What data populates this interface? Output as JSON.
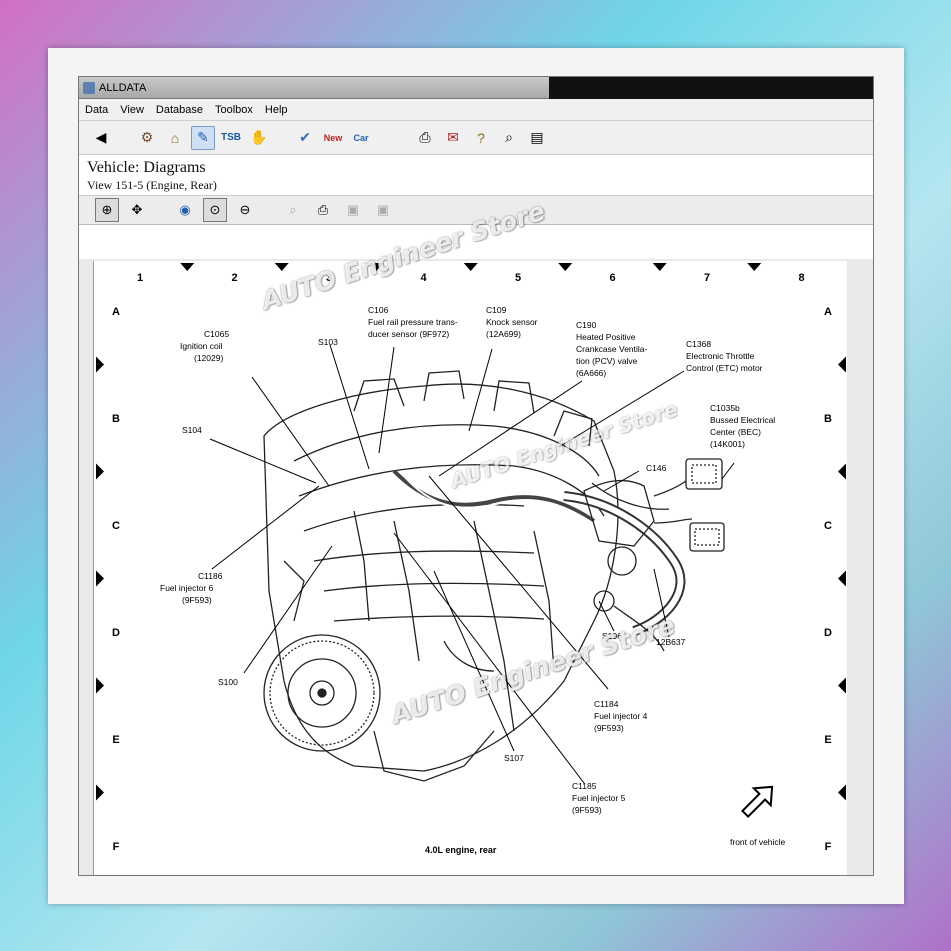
{
  "window": {
    "title": "ALLDATA"
  },
  "menu": [
    "Data",
    "View",
    "Database",
    "Toolbox",
    "Help"
  ],
  "toolbar_icons": [
    "back-icon",
    "component-icon",
    "home-icon",
    "diagram-tool-icon",
    "tsb-icon",
    "wrench-icon",
    "repair-icon",
    "new-car-icon",
    "new-car-2-icon",
    "print-icon",
    "note-icon",
    "help-icon",
    "search-icon",
    "print-preview-icon"
  ],
  "vehicle": {
    "title": "Vehicle:  Diagrams",
    "view": "View 151-5 (Engine, Rear)"
  },
  "diagram_tools": [
    "zoom-box-icon",
    "pan-icon",
    "zoom-100-icon",
    "zoom-in-icon",
    "zoom-out-icon",
    "zoom-disabled-icon",
    "print-icon",
    "camera-icon",
    "camera-2-icon"
  ],
  "diagram": {
    "columns": [
      "1",
      "2",
      "3",
      "4",
      "5",
      "6",
      "7",
      "8"
    ],
    "rows": [
      "A",
      "B",
      "C",
      "D",
      "E",
      "F"
    ],
    "caption": "4.0L engine, rear",
    "front_label": "front of vehicle",
    "callouts": [
      {
        "id": "c1065",
        "lines": [
          "C1065",
          "Ignition coil",
          "(12029)"
        ]
      },
      {
        "id": "c106",
        "lines": [
          "C106",
          "Fuel rail pressure trans-",
          "ducer sensor (9F972)"
        ]
      },
      {
        "id": "c109",
        "lines": [
          "C109",
          "Knock sensor",
          "(12A699)"
        ]
      },
      {
        "id": "c190",
        "lines": [
          "C190",
          "Heated Positive",
          "Crankcase Ventila-",
          "tion (PCV) valve",
          "(6A666)"
        ]
      },
      {
        "id": "c1368",
        "lines": [
          "C1368",
          "Electronic Throttle",
          "Control (ETC) motor"
        ]
      },
      {
        "id": "c1035b",
        "lines": [
          "C1035b",
          "Bussed Electrical",
          "Center (BEC)",
          "(14K001)"
        ]
      },
      {
        "id": "s103",
        "lines": [
          "S103"
        ]
      },
      {
        "id": "s104",
        "lines": [
          "S104"
        ]
      },
      {
        "id": "c146",
        "lines": [
          "C146"
        ]
      },
      {
        "id": "c1186",
        "lines": [
          "C1186",
          "Fuel injector 6",
          "(9F593)"
        ]
      },
      {
        "id": "s100",
        "lines": [
          "S100"
        ]
      },
      {
        "id": "s106",
        "lines": [
          "S106"
        ]
      },
      {
        "id": "12b637",
        "lines": [
          "12B637"
        ]
      },
      {
        "id": "c1184",
        "lines": [
          "C1184",
          "Fuel injector 4",
          "(9F593)"
        ]
      },
      {
        "id": "s107",
        "lines": [
          "S107"
        ]
      },
      {
        "id": "c1185",
        "lines": [
          "C1185",
          "Fuel injector 5",
          "(9F593)"
        ]
      }
    ]
  },
  "watermark": "AUTO Engineer Store"
}
